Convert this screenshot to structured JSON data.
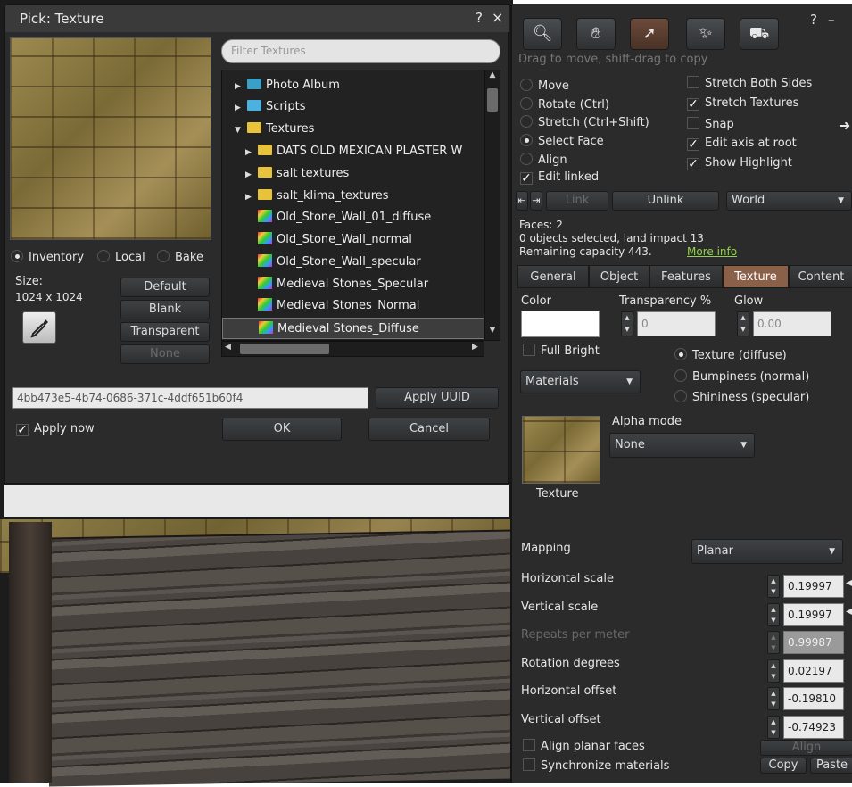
{
  "picker": {
    "title": "Pick: Texture",
    "help": "?",
    "close": "×",
    "filter_placeholder": "Filter Textures",
    "source_options": [
      "Inventory",
      "Local",
      "Bake"
    ],
    "size_label": "Size:",
    "size_value": "1024 x 1024",
    "buttons": {
      "default": "Default",
      "blank": "Blank",
      "transparent": "Transparent",
      "none": "None"
    },
    "uuid": "4bb473e5-4b74-0686-371c-4ddf651b60f4",
    "apply_uuid": "Apply UUID",
    "apply_now": "Apply now",
    "ok": "OK",
    "cancel": "Cancel",
    "tree": [
      {
        "label": "Photo Album"
      },
      {
        "label": "Scripts"
      },
      {
        "label": "Textures"
      },
      {
        "label": "DATS OLD MEXICAN PLASTER W"
      },
      {
        "label": "salt textures"
      },
      {
        "label": "salt_klima_textures"
      },
      {
        "label": "Old_Stone_Wall_01_diffuse"
      },
      {
        "label": "Old_Stone_Wall_normal"
      },
      {
        "label": "Old_Stone_Wall_specular"
      },
      {
        "label": "Medieval Stones_Specular"
      },
      {
        "label": "Medieval Stones_Normal"
      },
      {
        "label": "Medieval Stones_Diffuse"
      }
    ]
  },
  "build": {
    "help": "?",
    "minimize": "–",
    "hint": "Drag to move, shift-drag to copy",
    "edit_modes": [
      "Move",
      "Rotate (Ctrl)",
      "Stretch (Ctrl+Shift)",
      "Select Face",
      "Align"
    ],
    "edit_linked": "Edit linked",
    "checks": [
      "Stretch Both Sides",
      "Stretch Textures",
      "Snap",
      "Edit axis at root",
      "Show Highlight"
    ],
    "link": "Link",
    "unlink": "Unlink",
    "world": "World",
    "faces": "Faces: 2",
    "selected": "0 objects selected, land impact 13",
    "remaining": "Remaining capacity 443.",
    "more_info": "More info",
    "tabs": [
      "General",
      "Object",
      "Features",
      "Texture",
      "Content"
    ],
    "color_label": "Color",
    "transparency_label": "Transparency %",
    "transparency_value": "0",
    "glow_label": "Glow",
    "glow_value": "0.00",
    "full_bright": "Full Bright",
    "materials": "Materials",
    "texture_maps": [
      "Texture (diffuse)",
      "Bumpiness (normal)",
      "Shininess (specular)"
    ],
    "alpha_mode_label": "Alpha mode",
    "alpha_mode_value": "None",
    "texture_caption": "Texture",
    "mapping_label": "Mapping",
    "mapping_value": "Planar",
    "params": [
      {
        "label": "Horizontal scale",
        "value": "0.19997"
      },
      {
        "label": "Vertical scale",
        "value": "0.19997"
      },
      {
        "label": "Repeats per meter",
        "value": "0.99987"
      },
      {
        "label": "Rotation degrees",
        "value": "0.02197"
      },
      {
        "label": "Horizontal offset",
        "value": "-0.19810"
      },
      {
        "label": "Vertical offset",
        "value": "-0.74923"
      }
    ],
    "align_planar": "Align planar faces",
    "sync_materials": "Synchronize materials",
    "align_btn": "Align",
    "copy_btn": "Copy",
    "paste_btn": "Paste"
  },
  "colors": {
    "panel": "#2b2b2b",
    "accent_tab": "#8b6049",
    "link_green": "#8fd14f"
  }
}
